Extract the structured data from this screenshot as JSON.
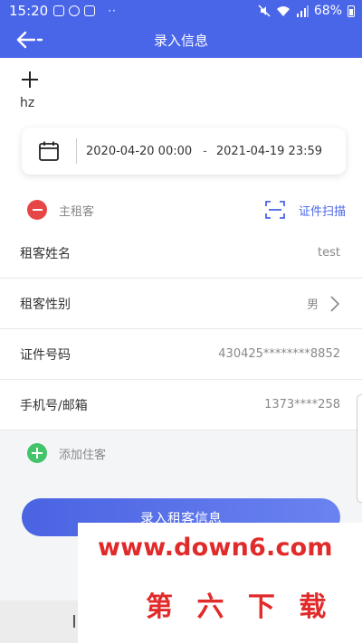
{
  "status_bar": {
    "time": "15:20",
    "dots": "··",
    "battery": "68%"
  },
  "nav": {
    "title": "录入信息"
  },
  "guest": {
    "name": "hz",
    "date_start": "2020-04-20 00:00",
    "date_dash": "-",
    "date_end": "2021-04-19 23:59"
  },
  "tenant": {
    "main_label": "主租客",
    "scan_label": "证件扫描"
  },
  "form": {
    "rows": [
      {
        "label": "租客姓名",
        "value": "test"
      },
      {
        "label": "租客性别",
        "value": "男"
      },
      {
        "label": "证件号码",
        "value": "430425********8852"
      },
      {
        "label": "手机号/邮箱",
        "value": "1373****258"
      }
    ]
  },
  "add_guest": {
    "label": "添加住客"
  },
  "submit": {
    "label": "录入租客信息"
  },
  "watermark": {
    "url": "www.down6.com",
    "name": "第 六 下 载"
  },
  "colors": {
    "brand": "#4a66e8",
    "danger": "#e64646",
    "success": "#43c36a",
    "watermark": "#e12a2a"
  },
  "icons": {
    "back": "arrow-left-icon",
    "add": "plus-icon",
    "calendar": "calendar-icon",
    "remove": "minus-circle-icon",
    "scan": "scan-icon",
    "chevron": "chevron-right-icon",
    "add_guest": "plus-circle-icon"
  }
}
